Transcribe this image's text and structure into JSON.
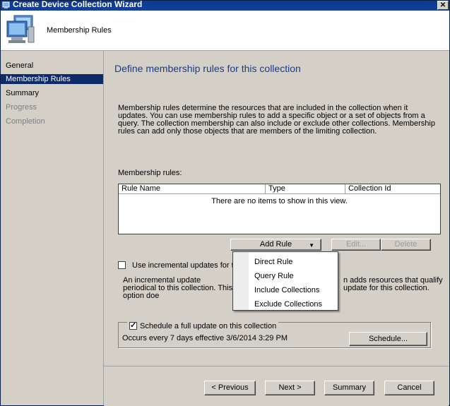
{
  "window": {
    "title": "Create Device Collection Wizard",
    "close_label": "✕"
  },
  "header": {
    "title": "Membership Rules",
    "icon": "computer-collection-icon"
  },
  "nav": {
    "items": [
      {
        "label": "General",
        "state": "normal"
      },
      {
        "label": "Membership Rules",
        "state": "selected"
      },
      {
        "label": "Summary",
        "state": "normal"
      },
      {
        "label": "Progress",
        "state": "disabled"
      },
      {
        "label": "Completion",
        "state": "disabled"
      }
    ]
  },
  "main": {
    "title": "Define membership rules for this collection",
    "description": "Membership rules determine the resources that are included in the collection when it updates. You can use membership rules to add a specific object or a set of objects from a query. The collection membership can also include or exclude other collections. Membership rules can add only those objects that are members of the limiting collection.",
    "rules_label": "Membership rules:",
    "table": {
      "columns": [
        "Rule Name",
        "Type",
        "Collection Id"
      ],
      "empty_text": "There are no items to show in this view."
    },
    "add_rule_label": "Add Rule",
    "edit_label": "Edit...",
    "delete_label": "Delete",
    "incremental": {
      "label": "Use incremental updates for this",
      "checked": false,
      "desc_left": "An incremental update periodical to this collection. This option doe",
      "desc_right": "n adds resources that qualify update for this collection."
    },
    "schedule": {
      "label": "Schedule a full update on this collection",
      "checked": true,
      "text": "Occurs every 7 days effective 3/6/2014 3:29 PM",
      "button_label": "Schedule..."
    },
    "add_rule_menu": [
      "Direct Rule",
      "Query Rule",
      "Include Collections",
      "Exclude Collections"
    ]
  },
  "footer": {
    "previous_label": "< Previous",
    "next_label": "Next >",
    "summary_label": "Summary",
    "cancel_label": "Cancel"
  },
  "colors": {
    "title_bar": "#0d3a8a",
    "selection": "#0e2a6b",
    "page_title": "#1c3a8c",
    "window_bg": "#d4d0c8"
  }
}
